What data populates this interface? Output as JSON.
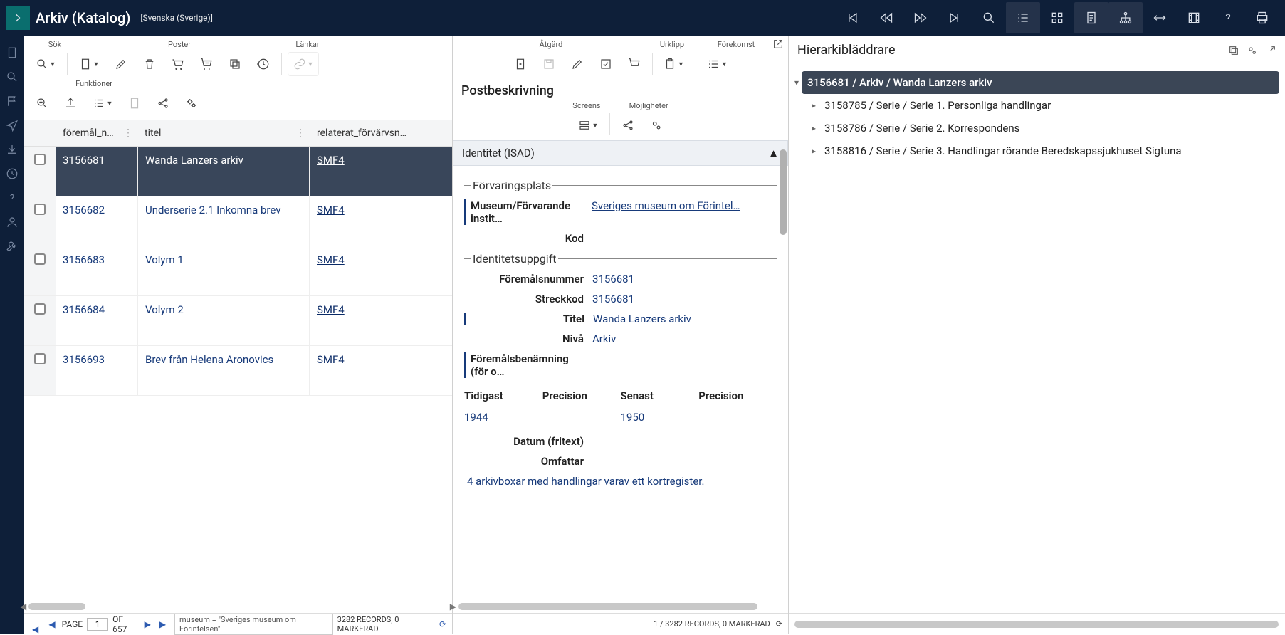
{
  "header": {
    "title": "Arkiv (Katalog)",
    "locale": "[Svenska (Sverige)]"
  },
  "leftPanel": {
    "labels": {
      "sok": "Sök",
      "poster": "Poster",
      "lankar": "Länkar",
      "funktioner": "Funktioner"
    },
    "columns": {
      "id": "föremål_n…",
      "title": "titel",
      "rel": "relaterat_förvärvsn…"
    },
    "rows": [
      {
        "id": "3156681",
        "title": "Wanda Lanzers arkiv",
        "rel": "SMF4",
        "selected": true
      },
      {
        "id": "3156682",
        "title": "Underserie 2.1 Inkomna brev",
        "rel": "SMF4",
        "selected": false
      },
      {
        "id": "3156683",
        "title": "Volym 1",
        "rel": "SMF4",
        "selected": false
      },
      {
        "id": "3156684",
        "title": "Volym 2",
        "rel": "SMF4",
        "selected": false
      },
      {
        "id": "3156693",
        "title": "Brev från Helena Aronovics",
        "rel": "SMF4",
        "selected": false
      }
    ],
    "pager": {
      "pageLabel": "PAGE",
      "page": "1",
      "ofLabel": "OF 657",
      "filter": "museum = \"Sveriges museum om Förintelsen\"",
      "records": "3282 RECORDS, 0 MARKERAD"
    }
  },
  "midPanel": {
    "labels": {
      "atgard": "Åtgärd",
      "urklipp": "Urklipp",
      "forekomst": "Förekomst",
      "screens": "Screens",
      "mojligheter": "Möjligheter"
    },
    "title": "Postbeskrivning",
    "sectionHeader": "Identitet (ISAD)",
    "sections": {
      "forvaringsplats": "Förvaringsplats",
      "identitetsuppgift": "Identitetsuppgift"
    },
    "fields": {
      "museumLabel": "Museum/Förvarande instit…",
      "museumValue": "Sveriges museum om Förintel…",
      "kodLabel": "Kod",
      "foremalsnummerLabel": "Föremålsnummer",
      "foremalsnummerValue": "3156681",
      "streckkodLabel": "Streckkod",
      "streckkodValue": "3156681",
      "titelLabel": "Titel",
      "titelValue": "Wanda Lanzers arkiv",
      "nivaLabel": "Nivå",
      "nivaValue": "Arkiv",
      "benamningLabel": "Föremålsbenämning (för o…",
      "tidigastLabel": "Tidigast",
      "precision1Label": "Precision",
      "senastLabel": "Senast",
      "precision2Label": "Precision",
      "tidigastValue": "1944",
      "senastValue": "1950",
      "datumFritextLabel": "Datum (fritext)",
      "omfattarLabel": "Omfattar",
      "omfattarValue": "4 arkivboxar med handlingar varav ett kortregister."
    },
    "status": "1 / 3282 RECORDS, 0 MARKERAD"
  },
  "rightPanel": {
    "title": "Hierarkibläddrare",
    "root": "3156681 / Arkiv / Wanda Lanzers arkiv",
    "children": [
      "3158785 / Serie / Serie 1. Personliga handlingar",
      "3158786 / Serie / Serie 2. Korrespondens",
      "3158816 / Serie / Serie 3. Handlingar rörande Beredskapssjukhuset Sigtuna"
    ]
  }
}
